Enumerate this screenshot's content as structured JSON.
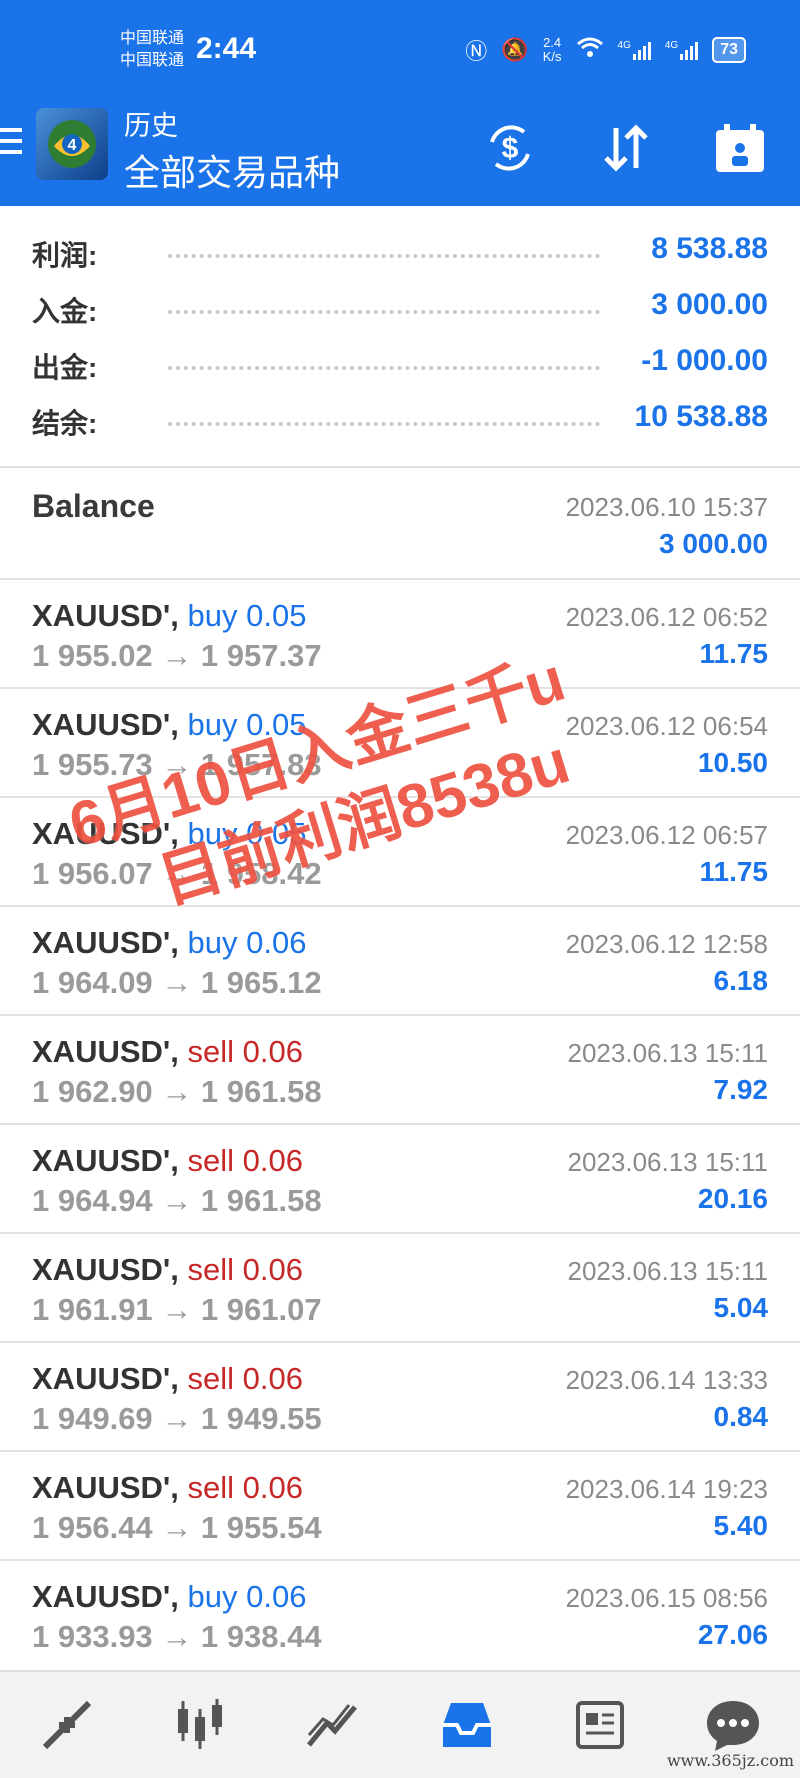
{
  "status_bar": {
    "carrier_1": "中国联通",
    "carrier_2": "中国联通",
    "time": "2:44",
    "net_speed_value": "2.4",
    "net_speed_unit": "K/s",
    "signal_1": "4G",
    "signal_2": "4G",
    "battery": "73"
  },
  "header": {
    "subtitle": "历史",
    "title": "全部交易品种",
    "buttons": [
      "dollar-refresh-icon",
      "sort-icon",
      "calendar-icon"
    ]
  },
  "summary": [
    {
      "label": "利润:",
      "value": "8 538.88"
    },
    {
      "label": "入金:",
      "value": "3 000.00"
    },
    {
      "label": "出金:",
      "value": "-1 000.00"
    },
    {
      "label": "结余:",
      "value": "10 538.88"
    }
  ],
  "balance": {
    "label": "Balance",
    "time": "2023.06.10 15:37",
    "amount": "3 000.00"
  },
  "trades": [
    {
      "symbol": "XAUUSD',",
      "side": "buy 0.05",
      "side_type": "buy",
      "prices": "1 955.02 → 1 957.37",
      "time": "2023.06.12 06:52",
      "profit": "11.75"
    },
    {
      "symbol": "XAUUSD',",
      "side": "buy 0.05",
      "side_type": "buy",
      "prices": "1 955.73 → 1 957.83",
      "time": "2023.06.12 06:54",
      "profit": "10.50"
    },
    {
      "symbol": "XAUUSD',",
      "side": "buy 0.05",
      "side_type": "buy",
      "prices": "1 956.07 → 1 958.42",
      "time": "2023.06.12 06:57",
      "profit": "11.75"
    },
    {
      "symbol": "XAUUSD',",
      "side": "buy 0.06",
      "side_type": "buy",
      "prices": "1 964.09 → 1 965.12",
      "time": "2023.06.12 12:58",
      "profit": "6.18"
    },
    {
      "symbol": "XAUUSD',",
      "side": "sell 0.06",
      "side_type": "sell",
      "prices": "1 962.90 → 1 961.58",
      "time": "2023.06.13 15:11",
      "profit": "7.92"
    },
    {
      "symbol": "XAUUSD',",
      "side": "sell 0.06",
      "side_type": "sell",
      "prices": "1 964.94 → 1 961.58",
      "time": "2023.06.13 15:11",
      "profit": "20.16"
    },
    {
      "symbol": "XAUUSD',",
      "side": "sell 0.06",
      "side_type": "sell",
      "prices": "1 961.91 → 1 961.07",
      "time": "2023.06.13 15:11",
      "profit": "5.04"
    },
    {
      "symbol": "XAUUSD',",
      "side": "sell 0.06",
      "side_type": "sell",
      "prices": "1 949.69 → 1 949.55",
      "time": "2023.06.14 13:33",
      "profit": "0.84"
    },
    {
      "symbol": "XAUUSD',",
      "side": "sell 0.06",
      "side_type": "sell",
      "prices": "1 956.44 → 1 955.54",
      "time": "2023.06.14 19:23",
      "profit": "5.40"
    },
    {
      "symbol": "XAUUSD',",
      "side": "buy 0.06",
      "side_type": "buy",
      "prices": "1 933.93 → 1 938.44",
      "time": "2023.06.15 08:56",
      "profit": "27.06"
    }
  ],
  "overlay": {
    "line_1": "6月10日入金三千u",
    "line_2": "目前利润8538u"
  },
  "bottom_nav": [
    {
      "icon": "quotes-arrows-icon",
      "active": false
    },
    {
      "icon": "candlestick-chart-icon",
      "active": false
    },
    {
      "icon": "trade-line-icon",
      "active": false
    },
    {
      "icon": "history-inbox-icon",
      "active": true
    },
    {
      "icon": "news-icon",
      "active": false
    },
    {
      "icon": "chat-icon",
      "active": false
    }
  ],
  "watermark": "www.365jz.com",
  "colors": {
    "accent": "#1a73e8",
    "sell": "#c62828",
    "overlay": "#eb3c28"
  }
}
